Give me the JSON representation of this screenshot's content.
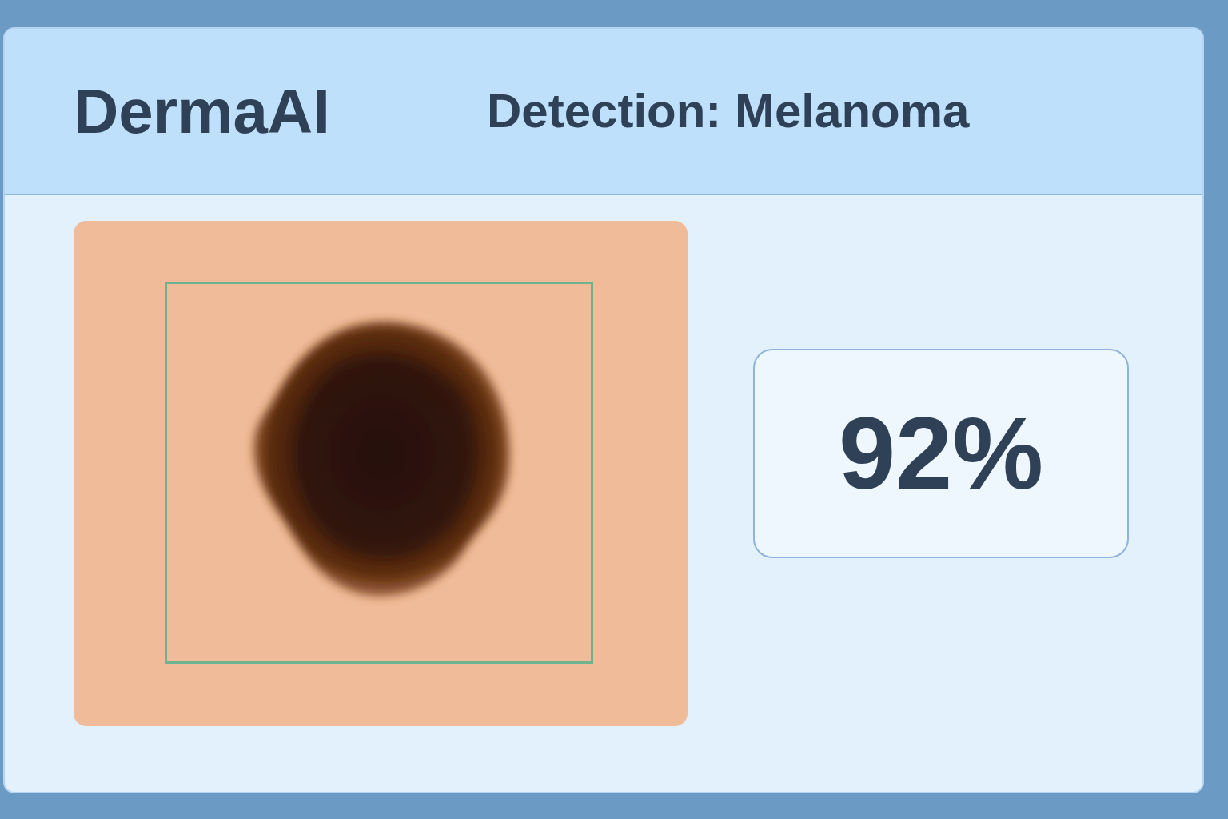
{
  "app": {
    "title": "DermaAI"
  },
  "detection": {
    "label": "Detection: Melanoma"
  },
  "confidence": {
    "value": "92%"
  }
}
